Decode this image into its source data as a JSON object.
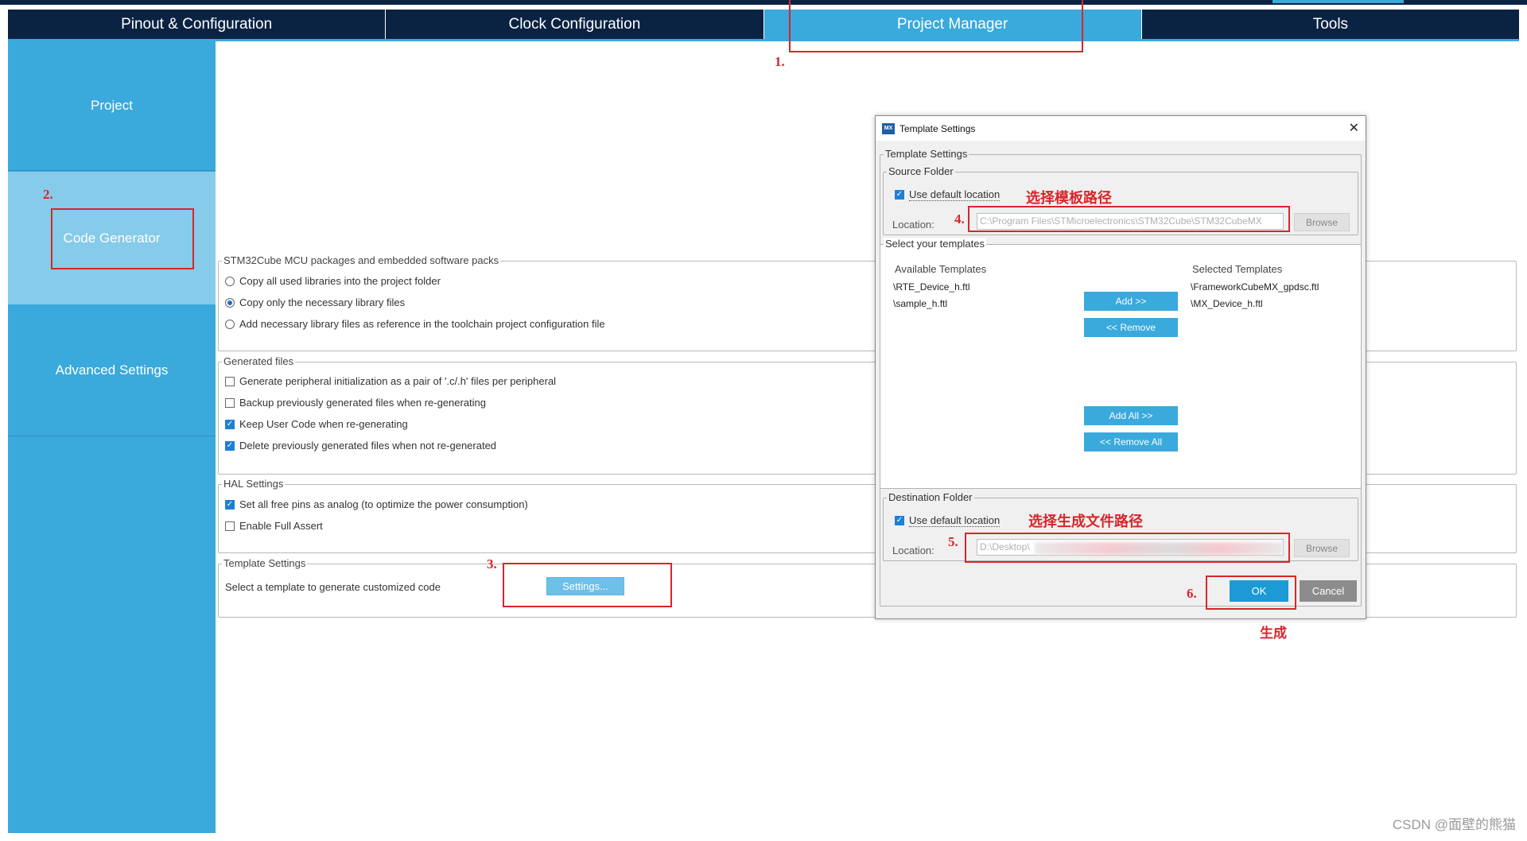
{
  "tabs": [
    {
      "label": "Pinout & Configuration"
    },
    {
      "label": "Clock Configuration"
    },
    {
      "label": "Project Manager"
    },
    {
      "label": "Tools"
    }
  ],
  "sidebar": {
    "project": "Project",
    "code_generator": "Code Generator",
    "advanced": "Advanced Settings"
  },
  "packages": {
    "legend": "STM32Cube MCU packages and embedded software packs",
    "opt1": "Copy all used libraries into the project folder",
    "opt2": "Copy only the necessary library files",
    "opt3": "Add necessary library files as reference in the toolchain project configuration file",
    "selected": 2
  },
  "generated": {
    "legend": "Generated files",
    "opt1": "Generate peripheral initialization as a pair of '.c/.h' files per peripheral",
    "opt2": "Backup previously generated files when re-generating",
    "opt3": "Keep User Code when re-generating",
    "opt4": "Delete previously generated files when not re-generated"
  },
  "hal": {
    "legend": "HAL Settings",
    "opt1": "Set all free pins as analog (to optimize the power consumption)",
    "opt2": "Enable Full Assert"
  },
  "template": {
    "legend": "Template Settings",
    "desc": "Select a template to generate customized code",
    "button": "Settings..."
  },
  "dialog": {
    "title": "Template Settings",
    "icon_text": "MX",
    "outer_legend": "Template Settings",
    "source_legend": "Source Folder",
    "use_default": "Use default location",
    "location_label": "Location:",
    "source_path": "C:\\Program Files\\STMicroelectronics\\STM32Cube\\STM32CubeMX",
    "browse": "Browse",
    "select_legend": "Select your templates",
    "available_header": "Available Templates",
    "selected_header": "Selected Templates",
    "available": [
      "\\RTE_Device_h.ftl",
      "\\sample_h.ftl"
    ],
    "selected": [
      "\\FrameworkCubeMX_gpdsc.ftl",
      "\\MX_Device_h.ftl"
    ],
    "add": "Add >>",
    "remove": "<< Remove",
    "add_all": "Add All >>",
    "remove_all": "<< Remove All",
    "dest_legend": "Destination Folder",
    "dest_path": "D:\\Desktop\\",
    "ok": "OK",
    "cancel": "Cancel"
  },
  "annotations": {
    "n1": "1.",
    "n2": "2.",
    "n3": "3.",
    "n4": "4.",
    "n5": "5.",
    "n6": "6.",
    "choose_template_path": "选择模板路径",
    "choose_output_path": "选择生成文件路径",
    "generate": "生成"
  },
  "watermark": "CSDN @面壁的熊猫",
  "colors": {
    "navy": "#0b2343",
    "accent": "#3aa9dc",
    "annotation_red": "#d7262b"
  }
}
